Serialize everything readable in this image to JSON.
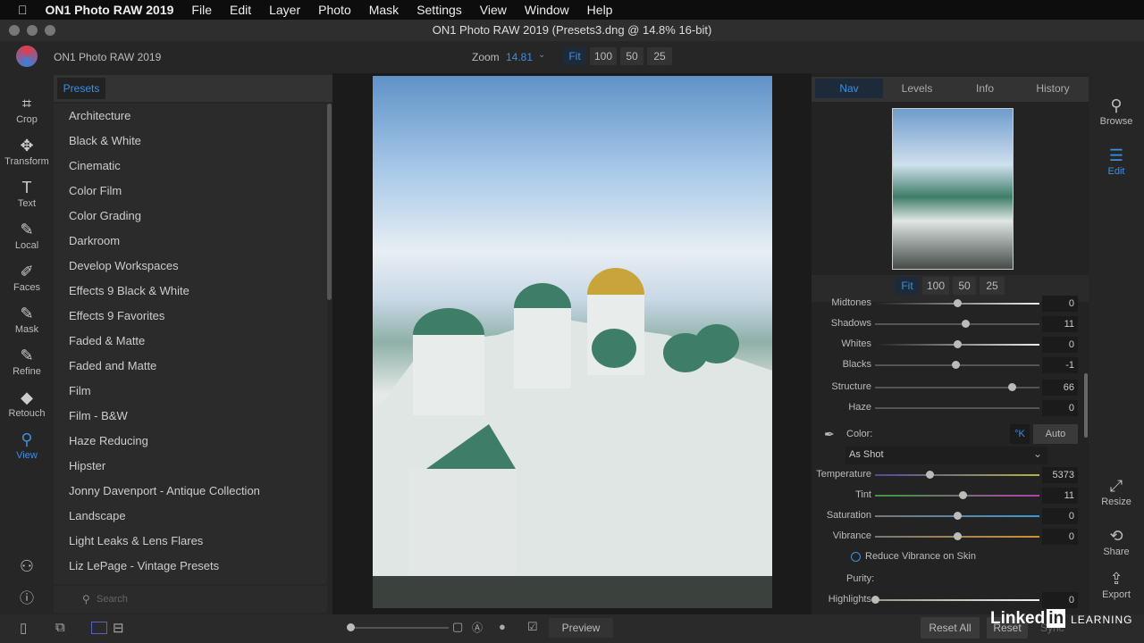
{
  "menubar": {
    "app": "ON1 Photo RAW 2019",
    "items": [
      "File",
      "Edit",
      "Layer",
      "Photo",
      "Mask",
      "Settings",
      "View",
      "Window",
      "Help"
    ]
  },
  "window_title": "ON1 Photo RAW 2019 (Presets3.dng @ 14.8% 16-bit)",
  "toolbar": {
    "app_name": "ON1 Photo RAW 2019",
    "zoom_label": "Zoom",
    "zoom_value": "14.81",
    "zoom_buttons": [
      "Fit",
      "100",
      "50",
      "25"
    ]
  },
  "tools": [
    {
      "label": "Crop",
      "icon": "⌗"
    },
    {
      "label": "Transform",
      "icon": "✥"
    },
    {
      "label": "Text",
      "icon": "T"
    },
    {
      "label": "Local",
      "icon": "✎"
    },
    {
      "label": "Faces",
      "icon": "✐"
    },
    {
      "label": "Mask",
      "icon": "✎"
    },
    {
      "label": "Refine",
      "icon": "✎"
    },
    {
      "label": "Retouch",
      "icon": "◆"
    },
    {
      "label": "View",
      "icon": "⚲"
    }
  ],
  "presets": {
    "tab": "Presets",
    "items": [
      "Architecture",
      "Black & White",
      "Cinematic",
      "Color Film",
      "Color Grading",
      "Darkroom",
      "Develop Workspaces",
      "Effects 9 Black & White",
      "Effects 9 Favorites",
      "Faded & Matte",
      "Faded and Matte",
      "Film",
      "Film - B&W",
      "Haze Reducing",
      "Hipster",
      "Jonny Davenport - Antique Collection",
      "Landscape",
      "Light Leaks & Lens Flares",
      "Liz LePage - Vintage Presets"
    ],
    "search_placeholder": "Search"
  },
  "right_panel": {
    "tabs": [
      "Nav",
      "Levels",
      "Info",
      "History"
    ],
    "nav_zoom": [
      "Fit",
      "100",
      "50",
      "25"
    ],
    "tone": [
      {
        "label": "Midtones",
        "value": "0",
        "pos": 0.5
      },
      {
        "label": "Shadows",
        "value": "11",
        "pos": 0.55
      },
      {
        "label": "Whites",
        "value": "0",
        "pos": 0.5
      },
      {
        "label": "Blacks",
        "value": "-1",
        "pos": 0.49
      },
      {
        "label": "Structure",
        "value": "66",
        "pos": 0.83
      },
      {
        "label": "Haze",
        "value": "0",
        "pos": null
      }
    ],
    "color_label": "Color:",
    "kelvin_btn": "°K",
    "auto_btn": "Auto",
    "wb_select": "As Shot",
    "color": [
      {
        "label": "Temperature",
        "value": "5373",
        "pos": 0.33
      },
      {
        "label": "Tint",
        "value": "11",
        "pos": 0.53
      },
      {
        "label": "Saturation",
        "value": "0",
        "pos": 0.5
      },
      {
        "label": "Vibrance",
        "value": "0",
        "pos": 0.5
      }
    ],
    "reduce_vibrance": "Reduce Vibrance on Skin",
    "purity_label": "Purity:",
    "highlights": {
      "label": "Highlights",
      "value": "0",
      "pos": 0
    }
  },
  "right_tools": [
    {
      "label": "Browse",
      "icon": "⚲"
    },
    {
      "label": "Edit",
      "icon": "☰"
    },
    {
      "label": "Resize",
      "icon": "⤢"
    },
    {
      "label": "Share",
      "icon": "⟲"
    },
    {
      "label": "Export",
      "icon": "⇪"
    }
  ],
  "bottom": {
    "preview": "Preview",
    "reset_all": "Reset All",
    "reset": "Reset",
    "sync": "Sync",
    "brand": "Linked",
    "brand_in": "in",
    "brand_learning": "LEARNING"
  }
}
